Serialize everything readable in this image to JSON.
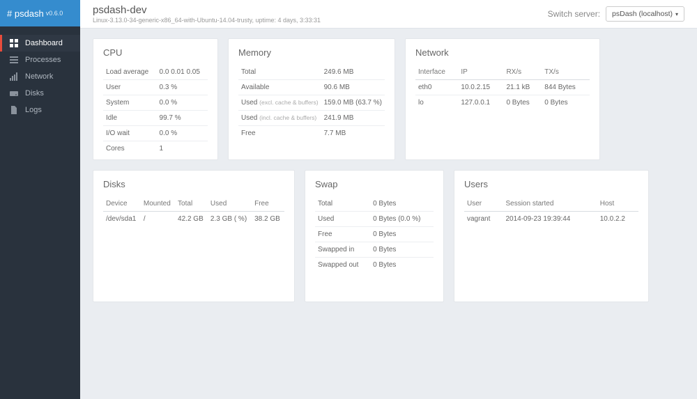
{
  "brand": {
    "name": "# psdash",
    "version": "v0.6.0"
  },
  "nav": {
    "items": [
      {
        "label": "Dashboard",
        "active": true
      },
      {
        "label": "Processes"
      },
      {
        "label": "Network"
      },
      {
        "label": "Disks"
      },
      {
        "label": "Logs"
      }
    ]
  },
  "header": {
    "title": "psdash-dev",
    "subtitle": "Linux-3.13.0-34-generic-x86_64-with-Ubuntu-14.04-trusty, uptime: 4 days, 3:33:31",
    "switch_label": "Switch server:",
    "server_selected": "psDash (localhost)"
  },
  "cpu": {
    "title": "CPU",
    "rows": {
      "load_label": "Load average",
      "load_value": "0.0   0.01   0.05",
      "user_label": "User",
      "user_value": "0.3 %",
      "system_label": "System",
      "system_value": "0.0 %",
      "idle_label": "Idle",
      "idle_value": "99.7 %",
      "iowait_label": "I/O wait",
      "iowait_value": "0.0 %",
      "cores_label": "Cores",
      "cores_value": "1"
    }
  },
  "memory": {
    "title": "Memory",
    "rows": {
      "total_label": "Total",
      "total_value": "249.6 MB",
      "avail_label": "Available",
      "avail_value": "90.6 MB",
      "usedex_label": "Used",
      "usedex_sub": "(excl. cache & buffers)",
      "usedex_value": "159.0 MB (63.7 %)",
      "usedin_label": "Used",
      "usedin_sub": "(incl. cache & buffers)",
      "usedin_value": "241.9 MB",
      "free_label": "Free",
      "free_value": "7.7 MB"
    }
  },
  "network": {
    "title": "Network",
    "headers": {
      "iface": "Interface",
      "ip": "IP",
      "rx": "RX/s",
      "tx": "TX/s"
    },
    "rows": [
      {
        "iface": "eth0",
        "ip": "10.0.2.15",
        "rx": "21.1 kB",
        "tx": "844 Bytes"
      },
      {
        "iface": "lo",
        "ip": "127.0.0.1",
        "rx": "0 Bytes",
        "tx": "0 Bytes"
      }
    ]
  },
  "disks": {
    "title": "Disks",
    "headers": {
      "device": "Device",
      "mounted": "Mounted",
      "total": "Total",
      "used": "Used",
      "free": "Free"
    },
    "rows": [
      {
        "device": "/dev/sda1",
        "mounted": "/",
        "total": "42.2 GB",
        "used": "2.3 GB ( %)",
        "free": "38.2 GB"
      }
    ]
  },
  "swap": {
    "title": "Swap",
    "rows": {
      "total_label": "Total",
      "total_value": "0 Bytes",
      "used_label": "Used",
      "used_value": "0 Bytes (0.0 %)",
      "free_label": "Free",
      "free_value": "0 Bytes",
      "in_label": "Swapped in",
      "in_value": "0 Bytes",
      "out_label": "Swapped out",
      "out_value": "0 Bytes"
    }
  },
  "users": {
    "title": "Users",
    "headers": {
      "user": "User",
      "session": "Session started",
      "host": "Host"
    },
    "rows": [
      {
        "user": "vagrant",
        "session": "2014-09-23 19:39:44",
        "host": "10.0.2.2"
      }
    ]
  }
}
